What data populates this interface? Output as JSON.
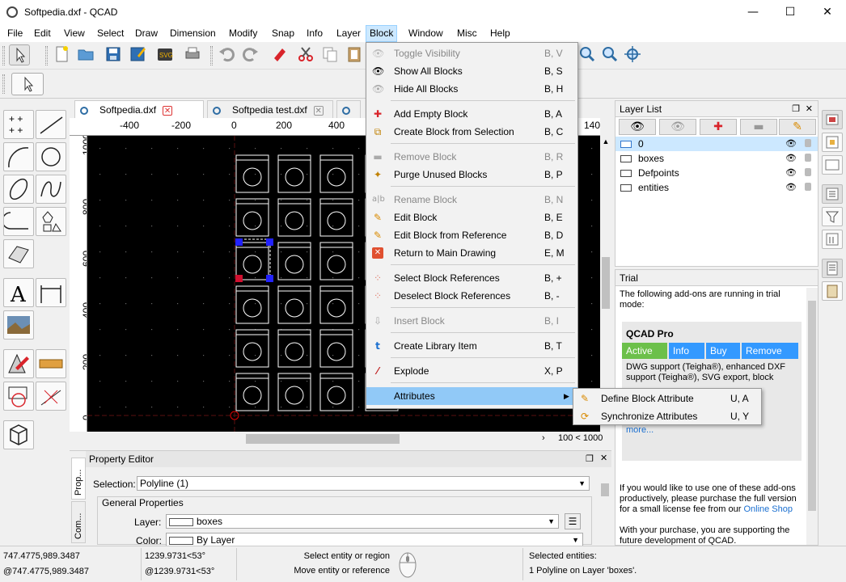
{
  "window": {
    "title": "Softpedia.dxf - QCAD",
    "minimize": "—",
    "maximize": "☐",
    "close": "✕"
  },
  "menubar": [
    "File",
    "Edit",
    "View",
    "Select",
    "Draw",
    "Dimension",
    "Modify",
    "Snap",
    "Info",
    "Layer",
    "Block",
    "Window",
    "Misc",
    "Help"
  ],
  "block_menu": {
    "items": [
      {
        "label": "Toggle Visibility",
        "shortcut": "B, V",
        "icon": "eye-icon",
        "enabled": false
      },
      {
        "label": "Show All Blocks",
        "shortcut": "B, S",
        "icon": "eye-icon",
        "enabled": true
      },
      {
        "label": "Hide All Blocks",
        "shortcut": "B, H",
        "icon": "eye-icon",
        "enabled": true
      },
      {
        "label": "Add Empty Block",
        "shortcut": "B, A",
        "icon": "plus-icon",
        "enabled": true
      },
      {
        "label": "Create Block from Selection",
        "shortcut": "B, C",
        "icon": "create-block-icon",
        "enabled": true
      },
      {
        "label": "Remove Block",
        "shortcut": "B, R",
        "icon": "minus-icon",
        "enabled": false
      },
      {
        "label": "Purge Unused Blocks",
        "shortcut": "B, P",
        "icon": "purge-icon",
        "enabled": true
      },
      {
        "label": "Rename Block",
        "shortcut": "B, N",
        "icon": "rename-icon",
        "enabled": false
      },
      {
        "label": "Edit Block",
        "shortcut": "B, E",
        "icon": "pencil-icon",
        "enabled": true
      },
      {
        "label": "Edit Block from Reference",
        "shortcut": "B, D",
        "icon": "pencil-reference-icon",
        "enabled": true
      },
      {
        "label": "Return to Main Drawing",
        "shortcut": "E, M",
        "icon": "return-icon",
        "enabled": true
      },
      {
        "label": "Select Block References",
        "shortcut": "B, +",
        "icon": "select-references-icon",
        "enabled": true
      },
      {
        "label": "Deselect Block References",
        "shortcut": "B, -",
        "icon": "deselect-references-icon",
        "enabled": true
      },
      {
        "label": "Insert Block",
        "shortcut": "B, I",
        "icon": "insert-block-icon",
        "enabled": false
      },
      {
        "label": "Create Library Item",
        "shortcut": "B, T",
        "icon": "library-item-icon",
        "enabled": true
      },
      {
        "label": "Explode",
        "shortcut": "X, P",
        "icon": "explode-icon",
        "enabled": true
      },
      {
        "label": "Attributes",
        "shortcut": "",
        "icon": "",
        "enabled": true,
        "highlighted": true
      }
    ],
    "submenu": [
      {
        "label": "Define Block Attribute",
        "shortcut": "U, A",
        "icon": "define-attribute-icon"
      },
      {
        "label": "Synchronize Attributes",
        "shortcut": "U, Y",
        "icon": "synchronize-icon"
      }
    ]
  },
  "tabs": [
    {
      "label": "Softpedia.dxf",
      "active": true
    },
    {
      "label": "Softpedia test.dxf",
      "active": false
    }
  ],
  "rulers": {
    "horizontal": [
      "-400",
      "-200",
      "0",
      "200",
      "400",
      "140"
    ],
    "vertical": [
      "1000",
      "800",
      "600",
      "400",
      "200",
      "0"
    ]
  },
  "canvas": {
    "zoom_label": "100 < 1000"
  },
  "property_editor": {
    "title": "Property Editor",
    "side_tabs": [
      "Prop...",
      "Com..."
    ],
    "selection_label": "Selection:",
    "selection_value": "Polyline (1)",
    "group_title": "General Properties",
    "layer_label": "Layer:",
    "layer_value": "boxes",
    "color_label": "Color:",
    "color_value": "By Layer"
  },
  "layer_list": {
    "title": "Layer List",
    "layers": [
      {
        "name": "0",
        "selected": true
      },
      {
        "name": "boxes",
        "selected": false
      },
      {
        "name": "Defpoints",
        "selected": false
      },
      {
        "name": "entities",
        "selected": false
      }
    ]
  },
  "trial": {
    "title": "Trial",
    "intro": "The following add-ons are running in trial mode:",
    "product": "QCAD Pro",
    "buttons": [
      "Active",
      "Info",
      "Buy",
      "Remove"
    ],
    "description": "DWG support (Teigha®), enhanced DXF support (Teigha®), SVG export, block",
    "more_link": "more...",
    "purchase_text": "If you would like to use one of these add-ons productively, please purchase the full version for a small license fee from our",
    "shop_link": "Online Shop",
    "support_text": "With your purchase, you are supporting the future development of QCAD.",
    "colors": {
      "active": "#6cc04a",
      "blue": "#3399ff"
    }
  },
  "statusbar": {
    "coord_abs": "747.4775,989.3487",
    "coord_rel": "@747.4775,989.3487",
    "polar_abs": "1239.9731<53°",
    "polar_rel": "@1239.9731<53°",
    "hint_left": "Select entity or region",
    "hint_right": "Move entity or reference",
    "selected_title": "Selected entities:",
    "selected_value": "1 Polyline on Layer 'boxes'."
  }
}
